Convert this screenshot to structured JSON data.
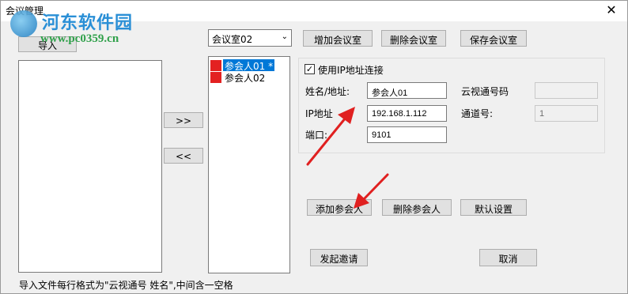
{
  "window": {
    "title": "会议管理",
    "close_glyph": "✕"
  },
  "watermark": {
    "site_name": "河东软件园",
    "url": "www.pc0359.cn"
  },
  "left": {
    "import_label": "导入"
  },
  "move": {
    "add_label": ">>",
    "remove_label": "<<"
  },
  "room": {
    "selected": "会议室02",
    "add_label": "增加会议室",
    "delete_label": "删除会议室",
    "save_label": "保存会议室"
  },
  "participants": [
    {
      "name": "参会人01 *",
      "selected": true
    },
    {
      "name": "参会人02",
      "selected": false
    }
  ],
  "details": {
    "use_ip_label": "使用IP地址连接",
    "use_ip_checked": "✓",
    "name_label": "姓名/地址:",
    "name_value": "参会人01",
    "ip_label": "IP地址",
    "ip_value": "192.168.1.112",
    "port_label": "端口:",
    "port_value": "9101",
    "cloud_label": "云视通号码",
    "cloud_value": "",
    "channel_label": "通道号:",
    "channel_value": "1"
  },
  "actions": {
    "add_participant": "添加参会人",
    "delete_participant": "删除参会人",
    "default_settings": "默认设置",
    "invite": "发起邀请",
    "cancel": "取消"
  },
  "hint": "导入文件每行格式为\"云视通号 姓名\",中间含一空格",
  "colors": {
    "participant_marker": "#e32121",
    "selection": "#0078d7",
    "annotation_arrow": "#e02020"
  }
}
